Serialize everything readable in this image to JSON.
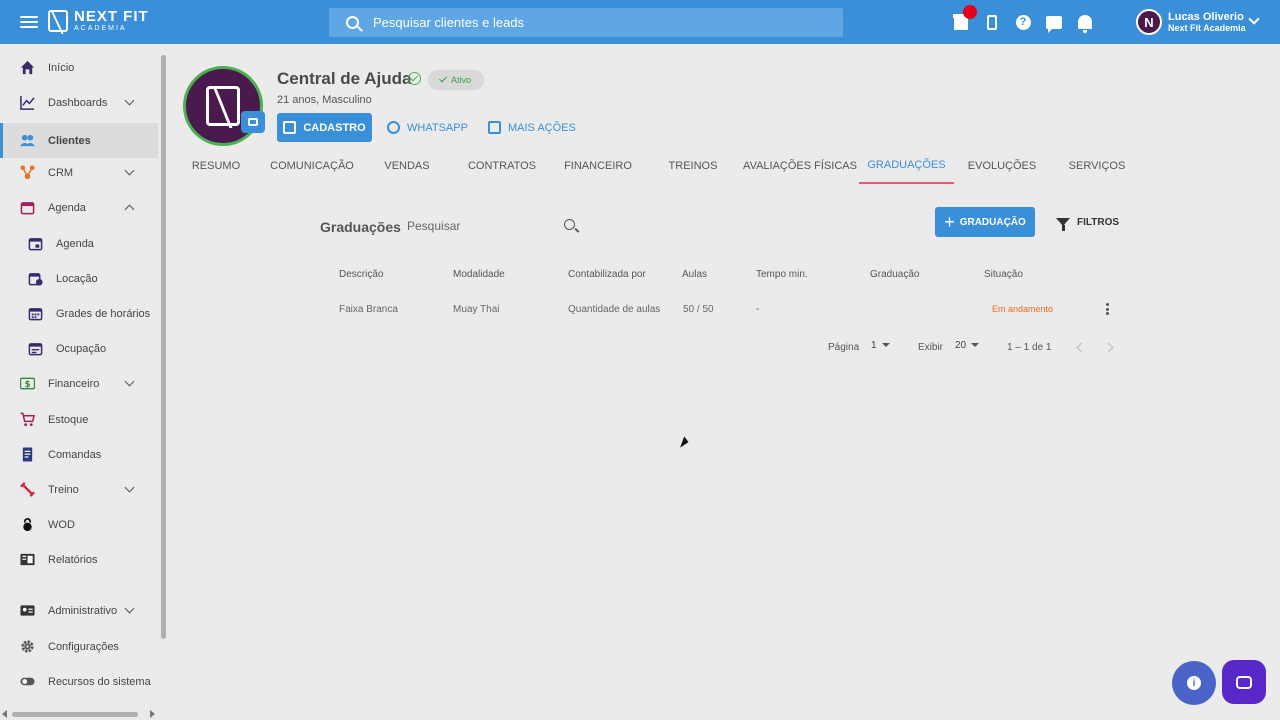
{
  "brand": {
    "name_line1": "NEXT FIT",
    "name_line2": "ACADEMIA"
  },
  "search": {
    "placeholder": "Pesquisar clientes e leads"
  },
  "user": {
    "initial": "N",
    "name": "Lucas Oliverio",
    "org": "Next Fit Academia"
  },
  "top_icons": [
    "gift-icon",
    "phone-icon",
    "help-icon",
    "chat-icon",
    "bell-icon"
  ],
  "sidebar": {
    "items": [
      {
        "label": "Início"
      },
      {
        "label": "Dashboards"
      },
      {
        "label": "Clientes"
      },
      {
        "label": "CRM"
      },
      {
        "label": "Agenda"
      },
      {
        "label": "Agenda"
      },
      {
        "label": "Locação"
      },
      {
        "label": "Grades de horários"
      },
      {
        "label": "Ocupação"
      },
      {
        "label": "Financeiro"
      },
      {
        "label": "Estoque"
      },
      {
        "label": "Comandas"
      },
      {
        "label": "Treino"
      },
      {
        "label": "WOD"
      },
      {
        "label": "Relatórios"
      },
      {
        "label": "Administrativo"
      },
      {
        "label": "Configurações"
      },
      {
        "label": "Recursos do sistema"
      }
    ]
  },
  "profile": {
    "name": "Central de Ajuda",
    "status": "Ativo",
    "subtitle": "21 anos, Masculino",
    "btn_cadastro": "CADASTRO",
    "btn_whatsapp": "WHATSAPP",
    "btn_mais": "MAIS AÇÕES"
  },
  "tabs": [
    {
      "label": "RESUMO"
    },
    {
      "label": "COMUNICAÇÃO"
    },
    {
      "label": "VENDAS"
    },
    {
      "label": "CONTRATOS"
    },
    {
      "label": "FINANCEIRO"
    },
    {
      "label": "TREINOS"
    },
    {
      "label": "AVALIAÇÕES FÍSICAS"
    },
    {
      "label": "GRADUAÇÕES"
    },
    {
      "label": "EVOLUÇÕES"
    },
    {
      "label": "SERVIÇOS"
    }
  ],
  "graduacoes": {
    "title": "Graduações",
    "search_placeholder": "Pesquisar",
    "btn_add": "GRADUAÇÃO",
    "btn_filters": "FILTROS",
    "columns": [
      "Descrição",
      "Modalidade",
      "Contabilizada por",
      "Aulas",
      "Tempo min.",
      "Graduação",
      "Situação"
    ],
    "rows": [
      {
        "descricao": "Faixa Branca",
        "modalidade": "Muay Thai",
        "contabilizada": "Quantidade de aulas",
        "aulas": "50 / 50",
        "tempo": "-",
        "graduacao": "",
        "situacao": "Em andamento"
      }
    ],
    "pagination": {
      "page_label": "Página",
      "page": "1",
      "show_label": "Exibir",
      "per_page": "20",
      "range": "1 – 1 de 1"
    }
  },
  "colors": {
    "primary": "#3a8fd9",
    "tab_underline": "#e35b73",
    "status_orange": "#e86a1f",
    "active_green": "#3b9c45",
    "avatar_bg": "#4a1a4f"
  }
}
